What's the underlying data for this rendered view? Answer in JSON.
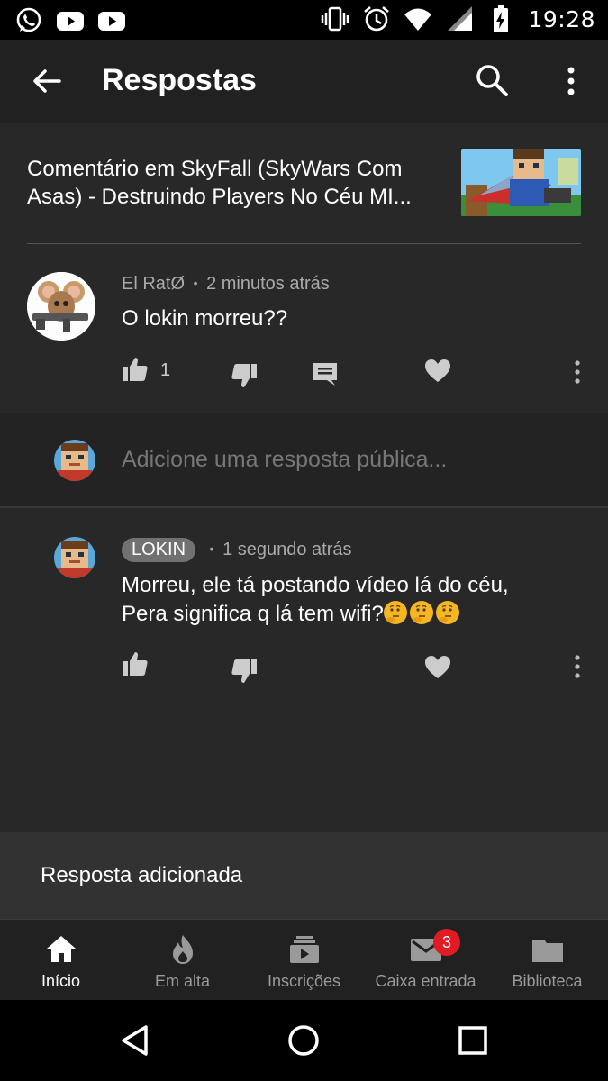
{
  "status_bar": {
    "time": "19:28",
    "left_icons": [
      "whatsapp-icon",
      "youtube-icon",
      "youtube-icon"
    ],
    "right_icons": [
      "vibrate-icon",
      "alarm-icon",
      "wifi-icon",
      "signal-icon",
      "battery-charging-icon"
    ]
  },
  "app_bar": {
    "title": "Respostas",
    "back_icon": "arrow-back-icon",
    "search_icon": "search-icon",
    "more_icon": "more-vert-icon"
  },
  "context": {
    "text": "Comentário em SkyFall (SkyWars Com Asas) - Destruindo Players No Céu MI..."
  },
  "comment": {
    "author": "El RatØ",
    "separator": "•",
    "time": "2 minutos atrás",
    "text": "O lokin morreu??",
    "like_count": "1"
  },
  "reply_input": {
    "placeholder": "Adicione uma resposta pública..."
  },
  "reply": {
    "author": "LOKIN",
    "separator": "•",
    "time": "1 segundo atrás",
    "line1": "Morreu, ele tá postando vídeo lá do céu,",
    "line2": "Pera significa q lá tem wifi?",
    "emoji": "thinking-face-emoji"
  },
  "snackbar": {
    "text": "Resposta adicionada"
  },
  "bottom_nav": {
    "items": [
      {
        "label": "Início",
        "icon": "home-icon",
        "active": true
      },
      {
        "label": "Em alta",
        "icon": "flame-icon",
        "active": false
      },
      {
        "label": "Inscrições",
        "icon": "subscriptions-icon",
        "active": false
      },
      {
        "label": "Caixa entrada",
        "icon": "mail-icon",
        "active": false
      },
      {
        "label": "Biblioteca",
        "icon": "folder-icon",
        "active": false
      }
    ],
    "inbox_badge": "3"
  },
  "colors": {
    "background": "#282828",
    "app_bar": "#212121",
    "badge_red": "#e01b24",
    "text_secondary": "#aaaaaa"
  }
}
